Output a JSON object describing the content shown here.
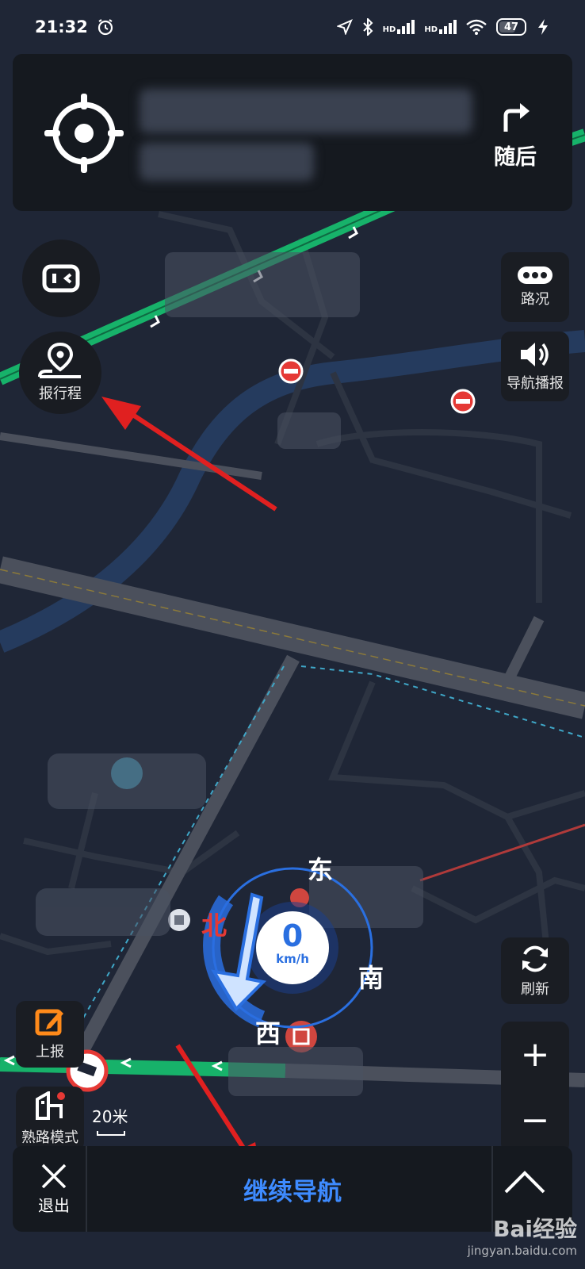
{
  "status_bar": {
    "time": "21:32",
    "network_labels": [
      "HD",
      "HD"
    ],
    "battery": "47"
  },
  "nav_card": {
    "turn_label": "随后"
  },
  "left_buttons": {
    "report_trip_label": "报行程",
    "report_label": "上报",
    "familiar_mode_label": "熟路模式"
  },
  "right_buttons": {
    "traffic_label": "路况",
    "voice_label": "导航播报",
    "refresh_label": "刷新",
    "zoom_in": "+",
    "zoom_out": "−"
  },
  "compass": {
    "north": "北",
    "south": "南",
    "east": "东",
    "west": "西",
    "speed": "0",
    "speed_unit": "km/h"
  },
  "scale": "20米",
  "bottom_bar": {
    "exit_label": "退出",
    "continue_label": "继续导航"
  },
  "watermark": {
    "brand": "Bai经验",
    "url": "jingyan.baidu.com"
  },
  "colors": {
    "route_green": "#17b26a",
    "continue_blue": "#3e8bff",
    "arrow_red": "#e02020",
    "compass_blue": "#2a6fe0"
  }
}
